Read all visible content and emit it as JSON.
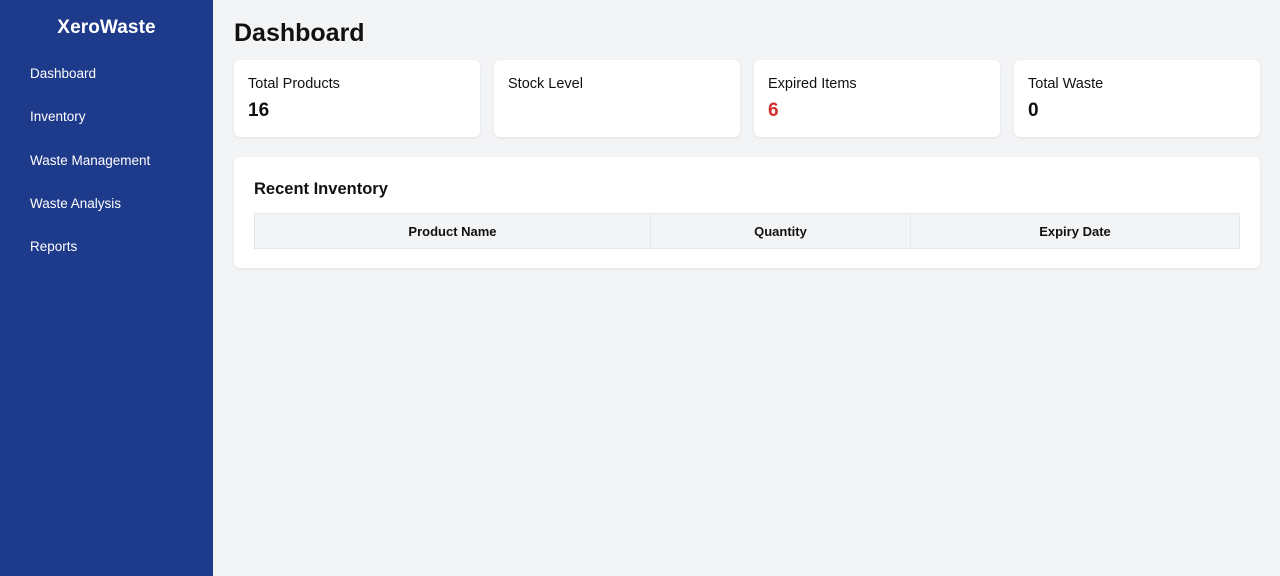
{
  "sidebar": {
    "brand": "XeroWaste",
    "items": [
      {
        "label": "Dashboard"
      },
      {
        "label": "Inventory"
      },
      {
        "label": "Waste Management"
      },
      {
        "label": "Waste Analysis"
      },
      {
        "label": "Reports"
      }
    ]
  },
  "main": {
    "title": "Dashboard",
    "cards": [
      {
        "label": "Total Products",
        "value": "16"
      },
      {
        "label": "Stock Level",
        "value": ""
      },
      {
        "label": "Expired Items",
        "value": "6"
      },
      {
        "label": "Total Waste",
        "value": "0"
      }
    ],
    "recent_inventory": {
      "title": "Recent Inventory",
      "columns": [
        "Product Name",
        "Quantity",
        "Expiry Date"
      ],
      "rows": []
    }
  },
  "colors": {
    "sidebar_bg": "#1e3a8a",
    "page_bg": "#f3f4f6",
    "danger": "#d32f2f"
  }
}
